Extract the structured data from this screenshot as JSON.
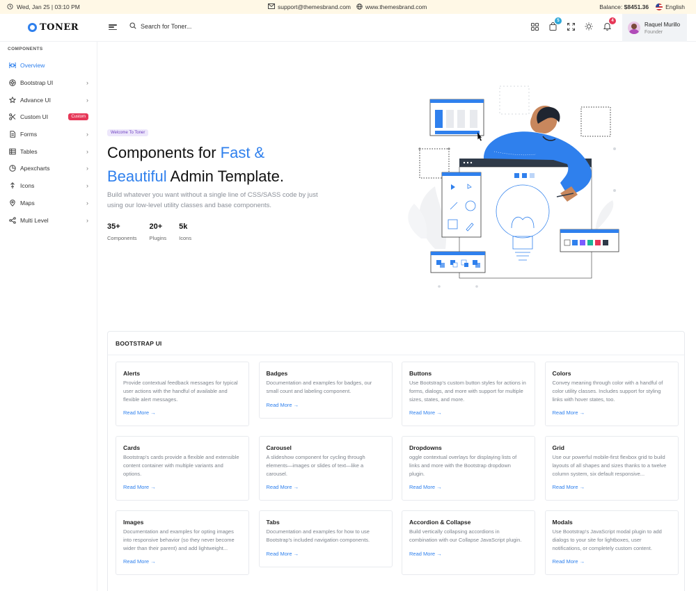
{
  "topbar": {
    "datetime": "Wed, Jan 25 | 03:10 PM",
    "email": "support@themesbrand.com",
    "website": "www.themesbrand.com",
    "balance_label": "Balance:",
    "balance_value": "$8451.36",
    "language": "English"
  },
  "header": {
    "brand": "TONER",
    "search_placeholder": "Search for Toner...",
    "cart_count": "5",
    "notification_count": "4",
    "user_name": "Raquel Murillo",
    "user_role": "Founder"
  },
  "sidebar": {
    "section": "COMPONENTS",
    "items": [
      {
        "label": "Overview",
        "icon": "overview-icon"
      },
      {
        "label": "Bootstrap UI",
        "icon": "bootstrap-icon"
      },
      {
        "label": "Advance UI",
        "icon": "advance-icon"
      },
      {
        "label": "Custom UI",
        "icon": "scissors-icon",
        "tag": "Custom"
      },
      {
        "label": "Forms",
        "icon": "form-icon"
      },
      {
        "label": "Tables",
        "icon": "table-icon"
      },
      {
        "label": "Apexcharts",
        "icon": "chart-icon"
      },
      {
        "label": "Icons",
        "icon": "icons-icon"
      },
      {
        "label": "Maps",
        "icon": "map-icon"
      },
      {
        "label": "Multi Level",
        "icon": "share-icon"
      }
    ]
  },
  "hero": {
    "tag": "Welcome To Toner",
    "title_part1": "Components for ",
    "title_blue1": "Fast &",
    "title_blue2": "Beautiful",
    "title_part2": " Admin Template.",
    "description": "Build whatever you want without a single line of CSS/SASS code by just using our low-level utility classes and base components.",
    "stats": [
      {
        "value": "35+",
        "label": "Components"
      },
      {
        "value": "20+",
        "label": "Plugins"
      },
      {
        "value": "5k",
        "label": "Icons"
      }
    ]
  },
  "bootstrap_panel": {
    "title": "BOOTSTRAP UI",
    "read_more": "Read More →",
    "cards": [
      {
        "title": "Alerts",
        "desc": "Provide contextual feedback messages for typical user actions with the handful of available and flexible alert messages."
      },
      {
        "title": "Badges",
        "desc": "Documentation and examples for badges, our small count and labeling component."
      },
      {
        "title": "Buttons",
        "desc": "Use Bootstrap's custom button styles for actions in forms, dialogs, and more with support for multiple sizes, states, and more."
      },
      {
        "title": "Colors",
        "desc": "Convey meaning through color with a handful of color utility classes. Includes support for styling links with hover states, too."
      },
      {
        "title": "Cards",
        "desc": "Bootstrap's cards provide a flexible and extensible content container with multiple variants and options."
      },
      {
        "title": "Carousel",
        "desc": "A slideshow component for cycling through elements—images or slides of text—like a carousel."
      },
      {
        "title": "Dropdowns",
        "desc": "oggle contextual overlays for displaying lists of links and more with the Bootstrap dropdown plugin."
      },
      {
        "title": "Grid",
        "desc": "Use our powerful mobile-first flexbox grid to build layouts of all shapes and sizes thanks to a twelve column system, six default responsive..."
      },
      {
        "title": "Images",
        "desc": "Documentation and examples for opting images into responsive behavior (so they never become wider than their parent) and add lightweight..."
      },
      {
        "title": "Tabs",
        "desc": "Documentation and examples for how to use Bootstrap's included navigation components."
      },
      {
        "title": "Accordion & Collapse",
        "desc": "Build vertically collapsing accordions in combination with our Collapse JavaScript plugin."
      },
      {
        "title": "Modals",
        "desc": "Use Bootstrap's JavaScript modal plugin to add dialogs to your site for lightboxes, user notifications, or completely custom content."
      }
    ]
  },
  "colors": {
    "accent": "#2f80ed",
    "topbar_bg": "#fff8e6",
    "custom_tag": "#e63757",
    "badge_cart": "#2fa8d8",
    "badge_notify": "#e63757"
  }
}
